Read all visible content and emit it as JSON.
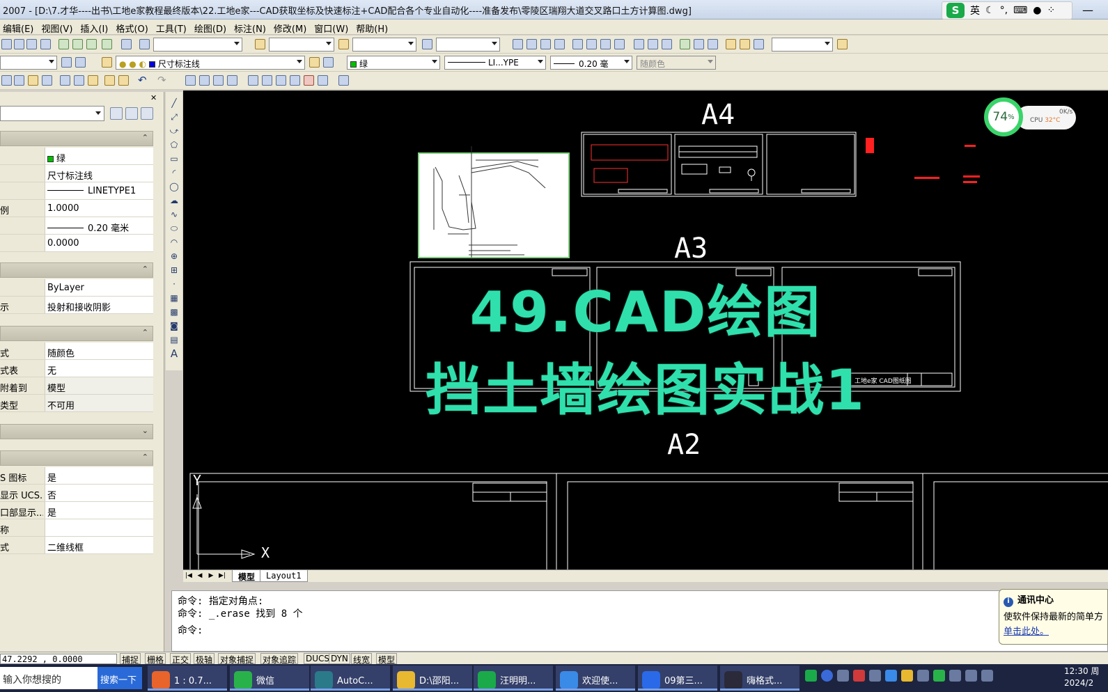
{
  "window": {
    "title": "2007 - [D:\\7.才华----出书\\工地e家教程最终版本\\22.工地e家---CAD获取坐标及快速标注+CAD配合各个专业自动化----准备发布\\零陵区瑞翔大道交叉路口土方计算图.dwg]",
    "ime_label": "英",
    "ime_logo": "S",
    "min_label": "—",
    "max_label": "□"
  },
  "menu": [
    "编辑(E)",
    "视图(V)",
    "插入(I)",
    "格式(O)",
    "工具(T)",
    "绘图(D)",
    "标注(N)",
    "修改(M)",
    "窗口(W)",
    "帮助(H)"
  ],
  "toolbar": {
    "layer_value": "尺寸标注线",
    "color_value": "绿",
    "linetype_value": "LI...YPE",
    "lineweight_value": "0.20 毫",
    "plotstyle_value": "随颜色"
  },
  "properties": {
    "sections": [
      {
        "rows": [
          {
            "key": "",
            "value": "绿",
            "kind": "color"
          },
          {
            "key": "",
            "value": "尺寸标注线"
          },
          {
            "key": "",
            "value": "LINETYPE1",
            "kind": "line"
          },
          {
            "key": "例",
            "value": "1.0000"
          },
          {
            "key": "",
            "value": "0.20 毫米",
            "kind": "line"
          },
          {
            "key": "",
            "value": "0.0000"
          }
        ]
      },
      {
        "rows": [
          {
            "key": "",
            "value": "ByLayer"
          },
          {
            "key": "示",
            "value": "投射和接收阴影"
          }
        ]
      },
      {
        "rows": [
          {
            "key": "式",
            "value": "随颜色"
          },
          {
            "key": "式表",
            "value": "无"
          },
          {
            "key": "附着到",
            "value": "模型",
            "grey": true
          },
          {
            "key": "类型",
            "value": "不可用",
            "grey": true
          }
        ]
      },
      {
        "rows": []
      },
      {
        "rows": [
          {
            "key": "S 图标",
            "value": "是"
          },
          {
            "key": "显示 UCS...",
            "value": "否"
          },
          {
            "key": "口部显示...",
            "value": "是"
          },
          {
            "key": "称",
            "value": ""
          },
          {
            "key": "式",
            "value": "二维线框"
          }
        ]
      }
    ]
  },
  "drawing": {
    "sheet_labels": [
      "A4",
      "A3",
      "A2"
    ],
    "overlay_line1": "49.CAD绘图",
    "overlay_line2": "挡土墙绘图实战1",
    "title_block_text": "工地e家 CAD图纸图",
    "ucs_y": "Y",
    "ucs_x": "X",
    "gauge_percent": "74",
    "gauge_percent_sign": "%",
    "gauge_speed": "0K/s",
    "gauge_cpu": "CPU",
    "gauge_temp": "32°C"
  },
  "layout_tabs": [
    "模型",
    "Layout1"
  ],
  "command_lines": [
    "命令: 指定对角点:",
    "命令: _.erase 找到 8 个",
    "命令:"
  ],
  "notification": {
    "title": "通讯中心",
    "body": "使软件保持最新的简单方",
    "link": "单击此处。"
  },
  "status": {
    "coords": "47.2292  , 0.0000",
    "buttons": [
      "捕捉",
      "栅格",
      "正交",
      "极轴",
      "对象捕捉",
      "对象追踪",
      "DUCS",
      "DYN",
      "线宽",
      "模型"
    ]
  },
  "taskbar": {
    "search_placeholder": "输入你想搜的",
    "search_button": "搜索一下",
    "tasks": [
      {
        "label": "1 : 0.7...",
        "color": "#e8642a"
      },
      {
        "label": "微信",
        "color": "#2ab24a"
      },
      {
        "label": "AutoC...",
        "color": "#2a7a8a"
      },
      {
        "label": "D:\\邵阳...",
        "color": "#e8b830"
      },
      {
        "label": "汪明明...",
        "color": "#1aaa4a"
      },
      {
        "label": "欢迎使...",
        "color": "#3a8ae8"
      },
      {
        "label": "09第三...",
        "color": "#2a6ae8"
      },
      {
        "label": "嗨格式...",
        "color": "#2a2a3a"
      }
    ],
    "clock_time": "12:30 周",
    "clock_date": "2024/2"
  },
  "colors": {
    "overlay_text": "#2fe0ad",
    "canvas_bg": "#000000",
    "layer_green": "#00c000",
    "notif_bg": "#fffde6"
  }
}
